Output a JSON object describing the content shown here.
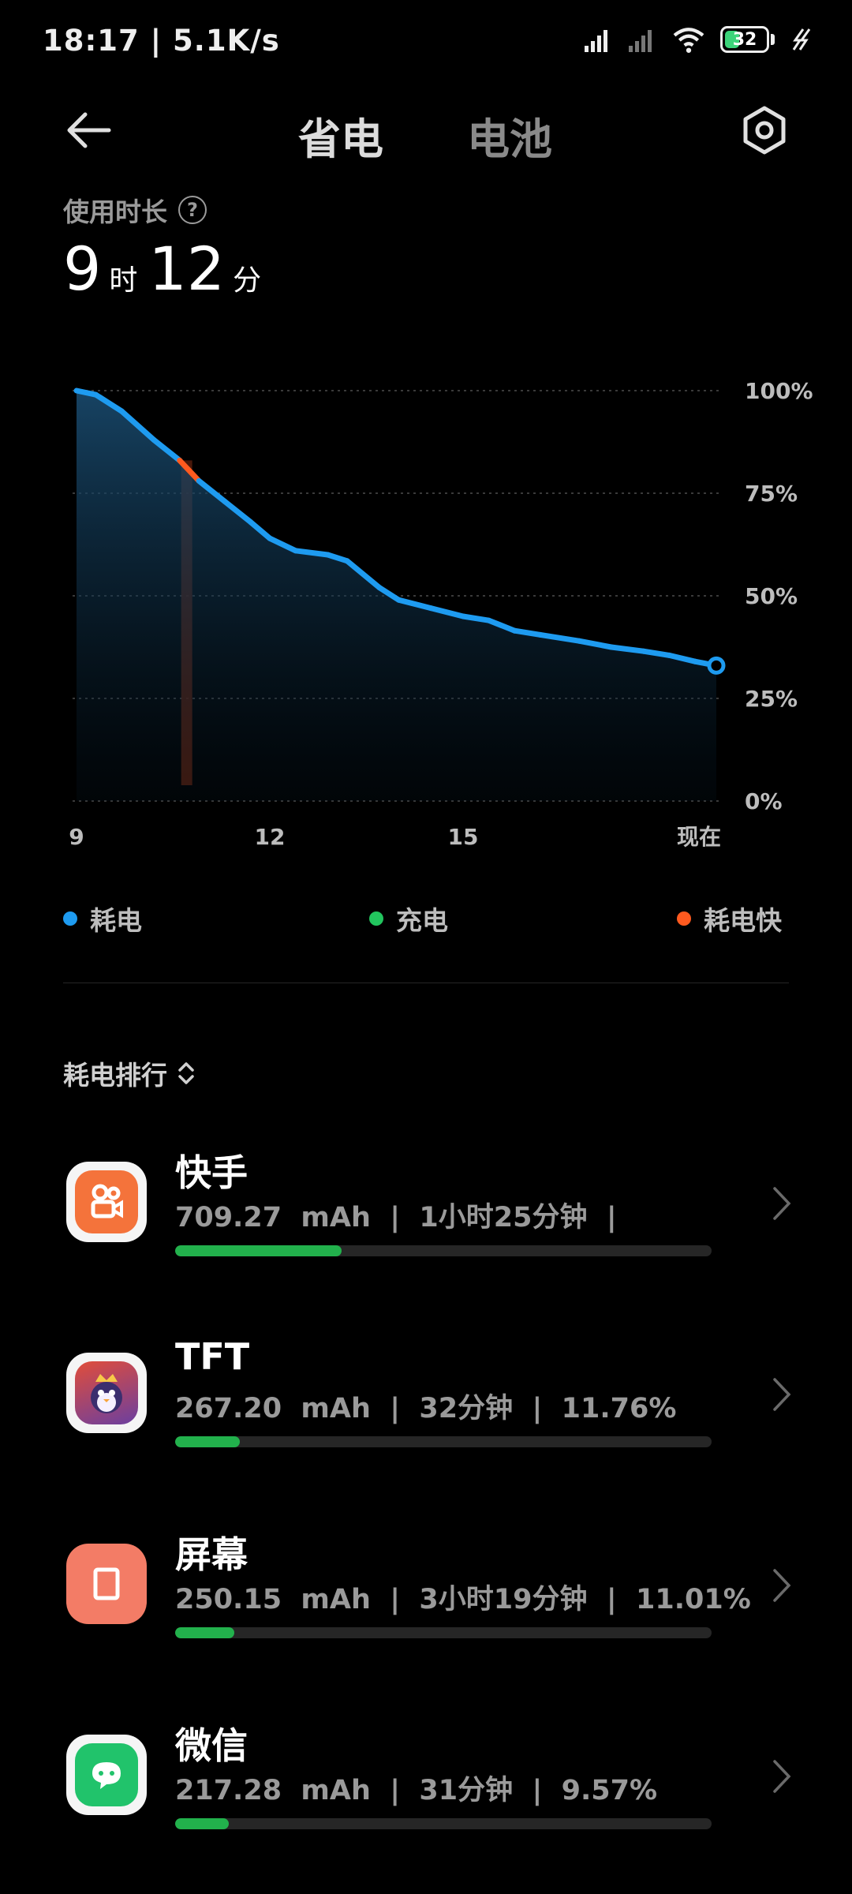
{
  "status_bar": {
    "time_speed": "18:17 | 5.1K/s",
    "battery_level": "32"
  },
  "header": {
    "tab_power_saving": "省电",
    "tab_battery": "电池"
  },
  "usage": {
    "label": "使用时长",
    "help": "?",
    "hours": "9",
    "hours_unit": "时",
    "minutes": "12",
    "minutes_unit": "分"
  },
  "chart_data": {
    "type": "area",
    "x_ticks": [
      "9",
      "12",
      "15",
      "现在"
    ],
    "y_ticks": [
      "100%",
      "75%",
      "50%",
      "25%",
      "0%"
    ],
    "ylim": [
      0,
      100
    ],
    "x": [
      9.0,
      9.3,
      9.7,
      10.2,
      10.6,
      10.9,
      11.3,
      11.7,
      12.0,
      12.4,
      12.9,
      13.2,
      13.7,
      14.0,
      14.5,
      15.0,
      15.4,
      15.8,
      16.2,
      16.8,
      17.3,
      17.8,
      18.2,
      18.6,
      18.93
    ],
    "y": [
      100,
      99,
      95,
      88,
      83,
      78,
      73,
      68,
      64,
      61,
      60,
      58.5,
      52,
      49,
      47,
      45,
      44,
      41.5,
      40.5,
      39,
      37.5,
      36.5,
      35.5,
      34,
      33
    ],
    "fast_drain_range": [
      10.6,
      10.9
    ],
    "grid": true,
    "legend_position": "bottom"
  },
  "legend": {
    "drain": "耗电",
    "charge": "充电",
    "fast_drain": "耗电快",
    "drain_color": "#1e9bf0",
    "charge_color": "#22c55e",
    "fast_color": "#ff5a1f"
  },
  "ranking": {
    "title": "耗电排行"
  },
  "apps": [
    {
      "name": "快手",
      "stats": "709.27  mAh  |  1小时25分钟  |",
      "fraction": 0.31,
      "icon": "kuaishou-icon",
      "color": "#f4733b"
    },
    {
      "name": "TFT",
      "stats": "267.20  mAh  |  32分钟  |  11.76%",
      "fraction": 0.12,
      "icon": "tft-icon",
      "color": "#5b3b8c"
    },
    {
      "name": "屏幕",
      "stats": "250.15  mAh  |  3小时19分钟  |  11.01%",
      "fraction": 0.11,
      "icon": "screen-icon",
      "color": "#f37c66"
    },
    {
      "name": "微信",
      "stats": "217.28  mAh  |  31分钟  |  9.57%",
      "fraction": 0.1,
      "icon": "wechat-icon",
      "color": "#21c36b"
    }
  ]
}
